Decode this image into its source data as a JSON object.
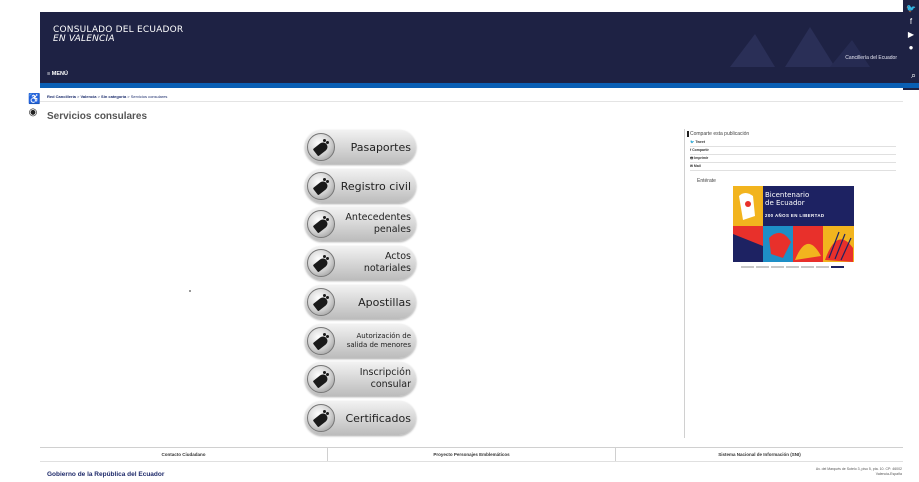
{
  "header": {
    "title_line1": "CONSULADO DEL ECUADOR",
    "title_line2": "EN VALENCIA",
    "link": "Cancillería del Ecuador"
  },
  "menu": {
    "label": "≡ MENÚ"
  },
  "breadcrumb": {
    "part1": "Red Cancillería",
    "part2": "Valencia",
    "part3": "Sin categoría",
    "current": "Servicios consulares",
    "sep": " > "
  },
  "page_title": "Servicios consulares",
  "services": [
    {
      "line1": "Pasaportes",
      "line2": ""
    },
    {
      "line1": "Registro civil",
      "line2": ""
    },
    {
      "line1": "Antecedentes",
      "line2": "penales"
    },
    {
      "line1": "Actos",
      "line2": "notariales"
    },
    {
      "line1": "Apostillas",
      "line2": ""
    },
    {
      "line1": "Autorización de",
      "line2": "salida de menores"
    },
    {
      "line1": "Inscripción",
      "line2": "consular"
    },
    {
      "line1": "Certificados",
      "line2": ""
    }
  ],
  "share": {
    "heading": "Comparte esta publicación",
    "items": [
      "🐦 Tweet",
      "f Compartir",
      "🖶 Imprimir",
      "✉ Mail"
    ]
  },
  "enterate": "Entérate",
  "banner": {
    "title1": "Bicentenario",
    "title2": "de Ecuador",
    "subtitle": "200 AÑOS EN LIBERTAD"
  },
  "footer": {
    "col1": "Contacto Ciudadano",
    "col2": "Proyecto Personajes Emblemáticos",
    "col3": "Sistema Nacional de Información (SNI)",
    "gov": "Gobierno de la República del Ecuador",
    "address1": "Av. del Marqués de Sotelo 3, piso 5, pta. 10. CP: 46002",
    "address2": "Valencia-España"
  },
  "colors": {
    "navy": "#1e2244",
    "accent": "#0a5fb4"
  }
}
